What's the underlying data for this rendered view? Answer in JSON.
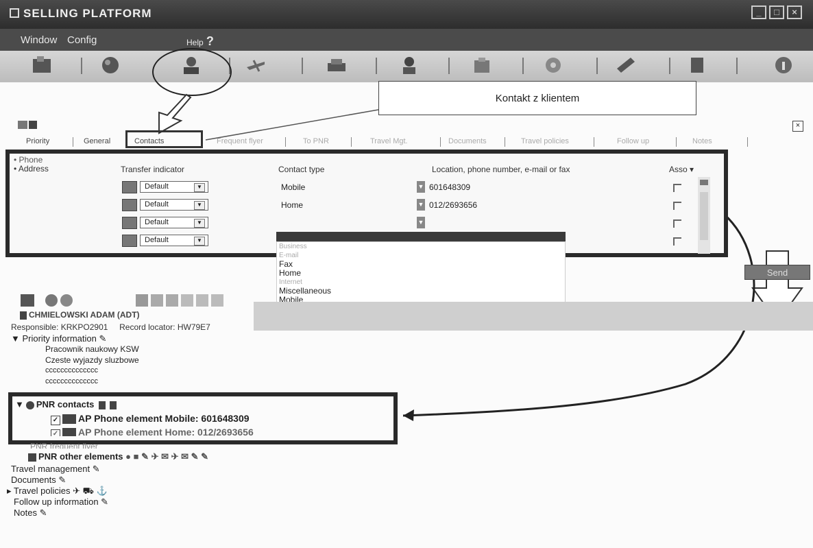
{
  "window": {
    "title": "SELLING PLATFORM"
  },
  "menu": {
    "window": "Window",
    "config": "Config",
    "help": "Help",
    "help_glyph": "?"
  },
  "callout": {
    "text": "Kontakt z klientem"
  },
  "tabs": {
    "priority": "Priority",
    "general": "General",
    "contacts": "Contacts",
    "frequent_flyer": "Frequent flyer",
    "to_pnr": "To PNR",
    "travel_mgt": "Travel Mgt.",
    "documents": "Documents",
    "travel_policies": "Travel policies",
    "follow_up": "Follow up",
    "notes": "Notes"
  },
  "contacts": {
    "left_nav": [
      "Phone",
      "Address"
    ],
    "headers": {
      "transfer": "Transfer indicator",
      "contact_type": "Contact type",
      "location": "Location, phone number, e-mail or fax",
      "assoc": "Asso"
    },
    "rows": [
      {
        "transfer": "Default",
        "type": "Mobile",
        "value": "601648309"
      },
      {
        "transfer": "Default",
        "type": "Home",
        "value": "012/2693656"
      },
      {
        "transfer": "Default",
        "type": "",
        "value": ""
      },
      {
        "transfer": "Default",
        "type": "",
        "value": ""
      }
    ],
    "dropdown_options": [
      "Business",
      "E-mail",
      "Fax",
      "Home",
      "Internet",
      "Miscellaneous",
      "Mobile"
    ],
    "send": "Send"
  },
  "record": {
    "name": "CHMIELOWSKI ADAM (ADT)",
    "responsible_label": "Responsible:",
    "responsible": "KRKPO2901",
    "locator_label": "Record locator:",
    "locator": "HW79E7",
    "priority_info": "Priority information",
    "priority_lines": [
      "Pracownik naukowy KSW",
      "Czeste wyjazdy sluzbowe",
      "cccccccccccccc",
      "cccccccccccccc"
    ],
    "pnr_contacts": "PNR contacts",
    "pnr_items": [
      "AP Phone element Mobile: 601648309",
      "AP Phone element Home: 012/2693656"
    ],
    "frequent_flyer": "PNR frequent flyer",
    "pnr_other": "PNR other elements",
    "travel_mgmt": "Travel management",
    "documents": "Documents",
    "travel_policies": "Travel policies",
    "follow_up": "Follow up information",
    "notes": "Notes"
  }
}
